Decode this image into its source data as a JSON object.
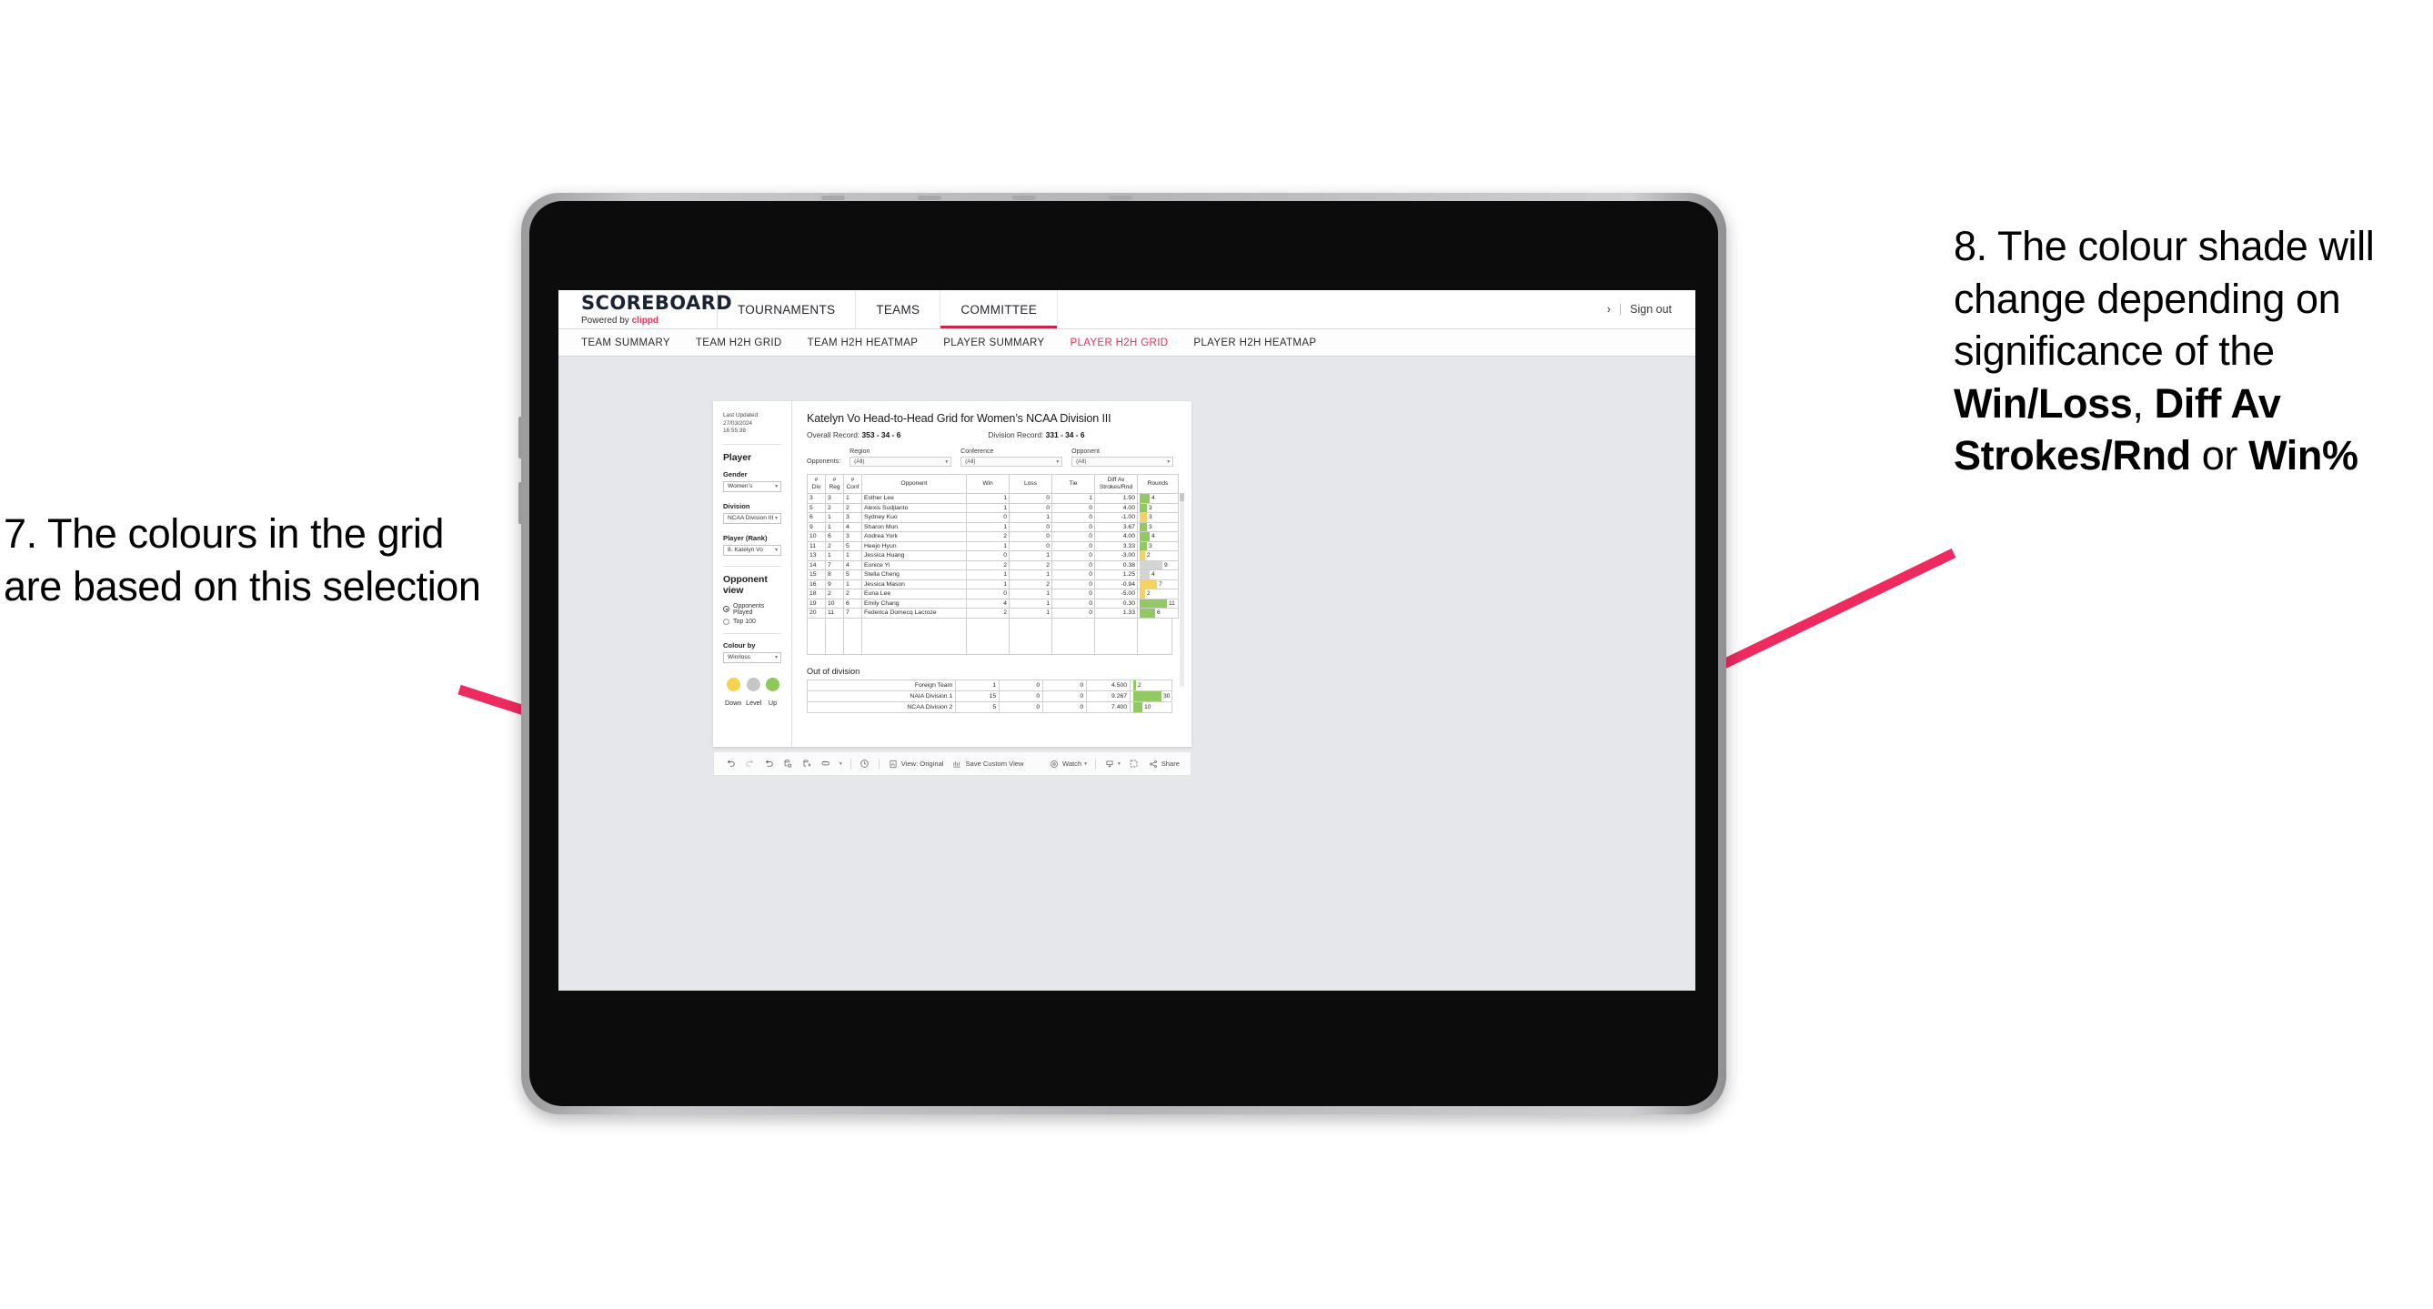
{
  "annotations": {
    "left": {
      "number": "7.",
      "text": "7. The colours in the grid are based on this selection"
    },
    "right": {
      "pre": "8. The colour shade will change depending on significance of the ",
      "b1": "Win/Loss",
      "mid1": ", ",
      "b2": "Diff Av Strokes/Rnd",
      "mid2": " or ",
      "b3": "Win%"
    },
    "arrow_color": "#ee2a5f"
  },
  "topnav": {
    "brand_title": "SCOREBOARD",
    "brand_sub_prefix": "Powered by ",
    "brand_sub_brand": "clippd",
    "items": [
      {
        "label": "TOURNAMENTS",
        "active": false
      },
      {
        "label": "TEAMS",
        "active": false
      },
      {
        "label": "COMMITTEE",
        "active": true
      }
    ],
    "chevron": "›",
    "separator": "|",
    "signout": "Sign out",
    "accent": "#c8254a"
  },
  "subnav": {
    "items": [
      {
        "label": "TEAM SUMMARY",
        "active": false
      },
      {
        "label": "TEAM H2H GRID",
        "active": false
      },
      {
        "label": "TEAM H2H HEATMAP",
        "active": false
      },
      {
        "label": "PLAYER SUMMARY",
        "active": false
      },
      {
        "label": "PLAYER H2H GRID",
        "active": true
      },
      {
        "label": "PLAYER H2H HEATMAP",
        "active": false
      }
    ],
    "active_color": "#e8325a"
  },
  "filters": {
    "last_updated_line1": "Last Updated: 27/03/2024",
    "last_updated_line2": "16:55:38",
    "player_heading": "Player",
    "gender_label": "Gender",
    "gender_value": "Women’s",
    "division_label": "Division",
    "division_value": "NCAA Division III",
    "player_rank_label": "Player (Rank)",
    "player_rank_value": "8. Katelyn Vo",
    "opponent_view_heading": "Opponent view",
    "opponent_view_options": [
      {
        "label": "Opponents Played",
        "selected": true
      },
      {
        "label": "Top 100",
        "selected": false
      }
    ],
    "colour_by_label": "Colour by",
    "colour_by_value": "Win/loss",
    "legend": [
      {
        "label": "Down",
        "color": "#f2d24f"
      },
      {
        "label": "Level",
        "color": "#c4c6c9"
      },
      {
        "label": "Up",
        "color": "#8ec75a"
      }
    ]
  },
  "viz": {
    "title": "Katelyn Vo Head-to-Head Grid for Women’s NCAA Division III",
    "overall_record_label": "Overall Record:",
    "overall_record_value": "353 -  34 - 6",
    "division_record_label": "Division Record:",
    "division_record_value": "331 -  34 - 6",
    "opponents_label": "Opponents:",
    "opponent_filters": [
      {
        "title": "Region",
        "value": "(All)"
      },
      {
        "title": "Conference",
        "value": "(All)"
      },
      {
        "title": "Opponent",
        "value": "(All)"
      }
    ],
    "out_of_division_title": "Out of division"
  },
  "chart_data": {
    "type": "table",
    "title": "Katelyn Vo Head-to-Head Grid for Women’s NCAA Division III",
    "columns": [
      "# Div",
      "# Reg",
      "# Conf",
      "Opponent",
      "Win",
      "Loss",
      "Tie",
      "Diff Av Strokes/Rnd",
      "Rounds"
    ],
    "column_headers_multiline": [
      [
        "#",
        "Div"
      ],
      [
        "#",
        "Reg"
      ],
      [
        "#",
        "Conf"
      ],
      [
        "Opponent"
      ],
      [
        "Win"
      ],
      [
        "Loss"
      ],
      [
        "Tie"
      ],
      [
        "Diff Av",
        "Strokes/Rnd"
      ],
      [
        "Rounds"
      ]
    ],
    "rounds_max": 12,
    "rows": [
      {
        "div": "3",
        "reg": "3",
        "conf": "1",
        "opponent": "Esther Lee",
        "win": "1",
        "loss": "0",
        "tie": "1",
        "diff": "1.50",
        "rounds": "4",
        "rounds_num": 4,
        "shade": "green"
      },
      {
        "div": "5",
        "reg": "2",
        "conf": "2",
        "opponent": "Alexis Sudjianto",
        "win": "1",
        "loss": "0",
        "tie": "0",
        "diff": "4.00",
        "rounds": "3",
        "rounds_num": 3,
        "shade": "green"
      },
      {
        "div": "6",
        "reg": "1",
        "conf": "3",
        "opponent": "Sydney Kuo",
        "win": "0",
        "loss": "1",
        "tie": "0",
        "diff": "-1.00",
        "rounds": "3",
        "rounds_num": 3,
        "shade": "yellow"
      },
      {
        "div": "9",
        "reg": "1",
        "conf": "4",
        "opponent": "Sharon Mun",
        "win": "1",
        "loss": "0",
        "tie": "0",
        "diff": "3.67",
        "rounds": "3",
        "rounds_num": 3,
        "shade": "green"
      },
      {
        "div": "10",
        "reg": "6",
        "conf": "3",
        "opponent": "Andrea York",
        "win": "2",
        "loss": "0",
        "tie": "0",
        "diff": "4.00",
        "rounds": "4",
        "rounds_num": 4,
        "shade": "green"
      },
      {
        "div": "11",
        "reg": "2",
        "conf": "5",
        "opponent": "Heejo Hyun",
        "win": "1",
        "loss": "0",
        "tie": "0",
        "diff": "3.33",
        "rounds": "3",
        "rounds_num": 3,
        "shade": "green"
      },
      {
        "div": "13",
        "reg": "1",
        "conf": "1",
        "opponent": "Jessica Huang",
        "win": "0",
        "loss": "1",
        "tie": "0",
        "diff": "-3.00",
        "rounds": "2",
        "rounds_num": 2,
        "shade": "yellow"
      },
      {
        "div": "14",
        "reg": "7",
        "conf": "4",
        "opponent": "Eunice Yi",
        "win": "2",
        "loss": "2",
        "tie": "0",
        "diff": "0.38",
        "rounds": "9",
        "rounds_num": 9,
        "shade": "grey",
        "diff_shade": "green"
      },
      {
        "div": "15",
        "reg": "8",
        "conf": "5",
        "opponent": "Stella Cheng",
        "win": "1",
        "loss": "1",
        "tie": "0",
        "diff": "1.25",
        "rounds": "4",
        "rounds_num": 4,
        "shade": "grey",
        "diff_shade": "green"
      },
      {
        "div": "16",
        "reg": "9",
        "conf": "1",
        "opponent": "Jessica Mason",
        "win": "1",
        "loss": "2",
        "tie": "0",
        "diff": "-0.94",
        "rounds": "7",
        "rounds_num": 7,
        "shade": "yellow"
      },
      {
        "div": "18",
        "reg": "2",
        "conf": "2",
        "opponent": "Euna Lee",
        "win": "0",
        "loss": "1",
        "tie": "0",
        "diff": "-5.00",
        "rounds": "2",
        "rounds_num": 2,
        "shade": "yellow"
      },
      {
        "div": "19",
        "reg": "10",
        "conf": "6",
        "opponent": "Emily Chang",
        "win": "4",
        "loss": "1",
        "tie": "0",
        "diff": "0.30",
        "rounds": "11",
        "rounds_num": 11,
        "shade": "green"
      },
      {
        "div": "20",
        "reg": "11",
        "conf": "7",
        "opponent": "Federica Domecq Lacroze",
        "win": "2",
        "loss": "1",
        "tie": "0",
        "diff": "1.33",
        "rounds": "6",
        "rounds_num": 6,
        "shade": "green"
      }
    ],
    "out_of_division": {
      "title": "Out of division",
      "rounds_max": 32,
      "rows": [
        {
          "name": "Foreign Team",
          "win": "1",
          "loss": "0",
          "tie": "0",
          "diff": "4.500",
          "rounds": "2",
          "rounds_num": 2,
          "shade": "green"
        },
        {
          "name": "NAIA Division 1",
          "win": "15",
          "loss": "0",
          "tie": "0",
          "diff": "9.267",
          "rounds": "30",
          "rounds_num": 30,
          "shade": "green"
        },
        {
          "name": "NCAA Division 2",
          "win": "5",
          "loss": "0",
          "tie": "0",
          "diff": "7.400",
          "rounds": "10",
          "rounds_num": 10,
          "shade": "green"
        }
      ]
    },
    "colors": {
      "green": "#93c962",
      "yellow": "#f5d264",
      "grey": "#d4d4d4"
    }
  },
  "toolbar": {
    "view_label": "View: Original",
    "save_label": "Save Custom View",
    "watch_label": "Watch",
    "share_label": "Share"
  }
}
